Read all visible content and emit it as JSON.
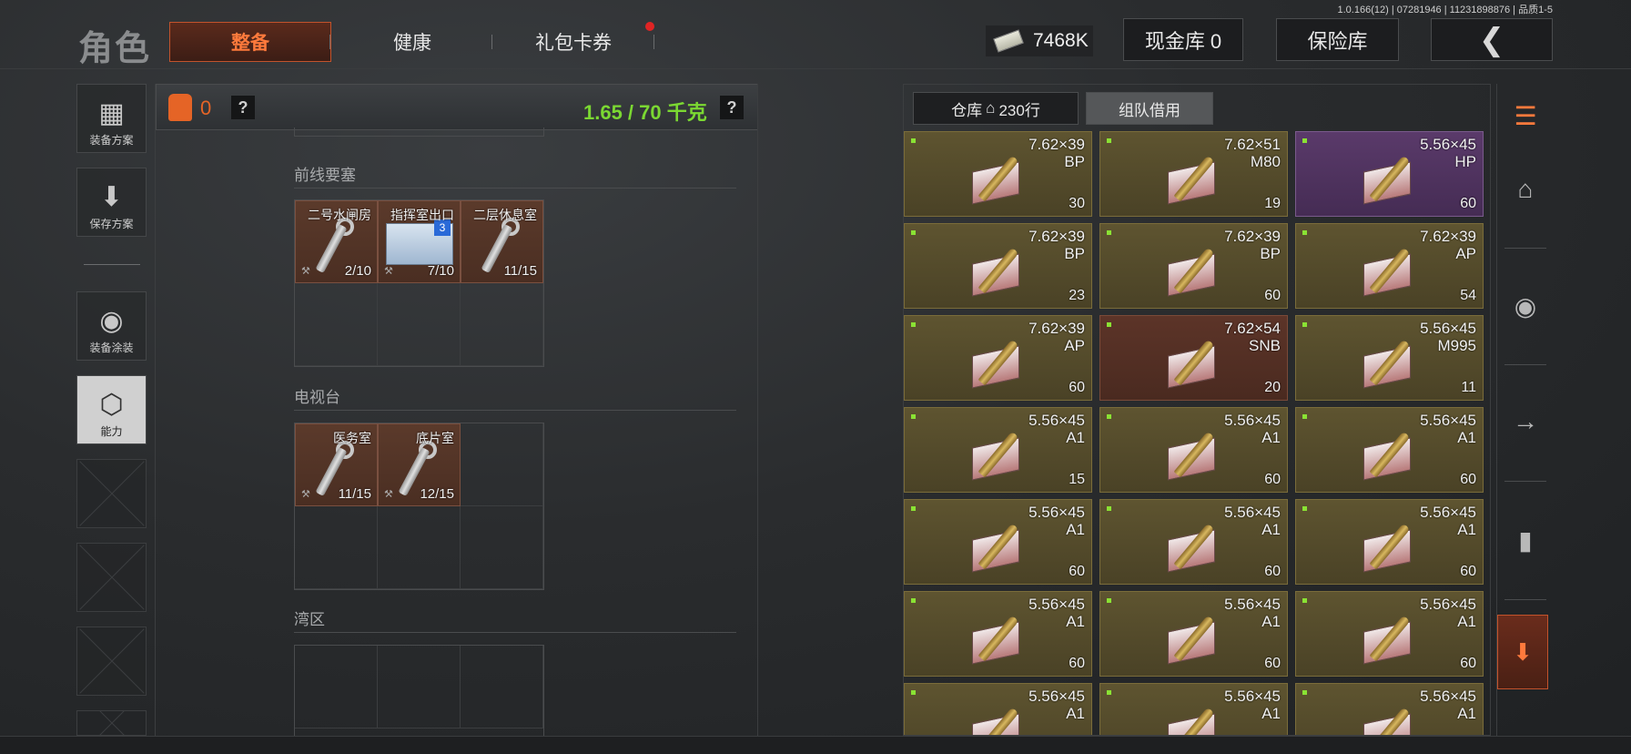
{
  "version": "1.0.166(12) | 07281946 | 11231898876 | 品质1-5",
  "header": {
    "title": "角色",
    "tabs": [
      {
        "label": "整备",
        "active": true
      },
      {
        "label": "健康",
        "active": false
      },
      {
        "label": "礼包卡券",
        "active": false,
        "badge": true
      }
    ],
    "cash_value": "7468K",
    "cash_vault_label": "现金库 0",
    "safe_label": "保险库",
    "back_icon": "chevron-left-icon"
  },
  "sidebar": {
    "items": [
      {
        "label": "装备方案",
        "icon": "vest-icon"
      },
      {
        "label": "保存方案",
        "icon": "download-icon"
      },
      {
        "label": "装备涂装",
        "icon": "helmet-icon"
      },
      {
        "label": "能力",
        "icon": "lightning-icon",
        "active": true
      }
    ]
  },
  "loadout": {
    "vest_count": "0",
    "weight": "1.65 / 70 千克",
    "help": "?",
    "sections": [
      {
        "title": "前线要塞",
        "keys": [
          {
            "name": "二号水闸房",
            "count": "2/10",
            "type": "key"
          },
          {
            "name": "指挥室出口",
            "count": "7/10",
            "type": "card",
            "badge": "3"
          },
          {
            "name": "二层休息室",
            "count": "11/15",
            "type": "key"
          }
        ]
      },
      {
        "title": "电视台",
        "keys": [
          {
            "name": "医务室",
            "count": "11/15",
            "type": "key"
          },
          {
            "name": "底片室",
            "count": "12/15",
            "type": "key"
          }
        ]
      },
      {
        "title": "湾区",
        "keys": []
      }
    ]
  },
  "storage": {
    "tabs": [
      {
        "label": "仓库",
        "sub": "230行",
        "active": false
      },
      {
        "label": "组队借用",
        "active": true
      }
    ],
    "items": [
      {
        "cal": "7.62×39",
        "type": "BP",
        "count": "30",
        "rarity": "gold"
      },
      {
        "cal": "7.62×51",
        "type": "M80",
        "count": "19",
        "rarity": "gold"
      },
      {
        "cal": "5.56×45",
        "type": "HP",
        "count": "60",
        "rarity": "purple"
      },
      {
        "cal": "7.62×39",
        "type": "BP",
        "count": "23",
        "rarity": "gold"
      },
      {
        "cal": "7.62×39",
        "type": "BP",
        "count": "60",
        "rarity": "gold"
      },
      {
        "cal": "7.62×39",
        "type": "AP",
        "count": "54",
        "rarity": "gold"
      },
      {
        "cal": "7.62×39",
        "type": "AP",
        "count": "60",
        "rarity": "gold"
      },
      {
        "cal": "7.62×54",
        "type": "SNB",
        "count": "20",
        "rarity": "red"
      },
      {
        "cal": "5.56×45",
        "type": "M995",
        "count": "11",
        "rarity": "gold"
      },
      {
        "cal": "5.56×45",
        "type": "A1",
        "count": "15",
        "rarity": "gold"
      },
      {
        "cal": "5.56×45",
        "type": "A1",
        "count": "60",
        "rarity": "gold"
      },
      {
        "cal": "5.56×45",
        "type": "A1",
        "count": "60",
        "rarity": "gold"
      },
      {
        "cal": "5.56×45",
        "type": "A1",
        "count": "60",
        "rarity": "gold"
      },
      {
        "cal": "5.56×45",
        "type": "A1",
        "count": "60",
        "rarity": "gold"
      },
      {
        "cal": "5.56×45",
        "type": "A1",
        "count": "60",
        "rarity": "gold"
      },
      {
        "cal": "5.56×45",
        "type": "A1",
        "count": "60",
        "rarity": "gold"
      },
      {
        "cal": "5.56×45",
        "type": "A1",
        "count": "60",
        "rarity": "gold"
      },
      {
        "cal": "5.56×45",
        "type": "A1",
        "count": "60",
        "rarity": "gold"
      },
      {
        "cal": "5.56×45",
        "type": "A1",
        "count": "",
        "rarity": "gold"
      },
      {
        "cal": "5.56×45",
        "type": "A1",
        "count": "",
        "rarity": "gold"
      },
      {
        "cal": "5.56×45",
        "type": "A1",
        "count": "",
        "rarity": "gold"
      }
    ]
  },
  "right_strip": {
    "icons": [
      "layers-refresh-icon",
      "home-icon",
      "helmet-icon",
      "rifle-icon",
      "magazine-icon",
      "vault-download-icon"
    ]
  }
}
